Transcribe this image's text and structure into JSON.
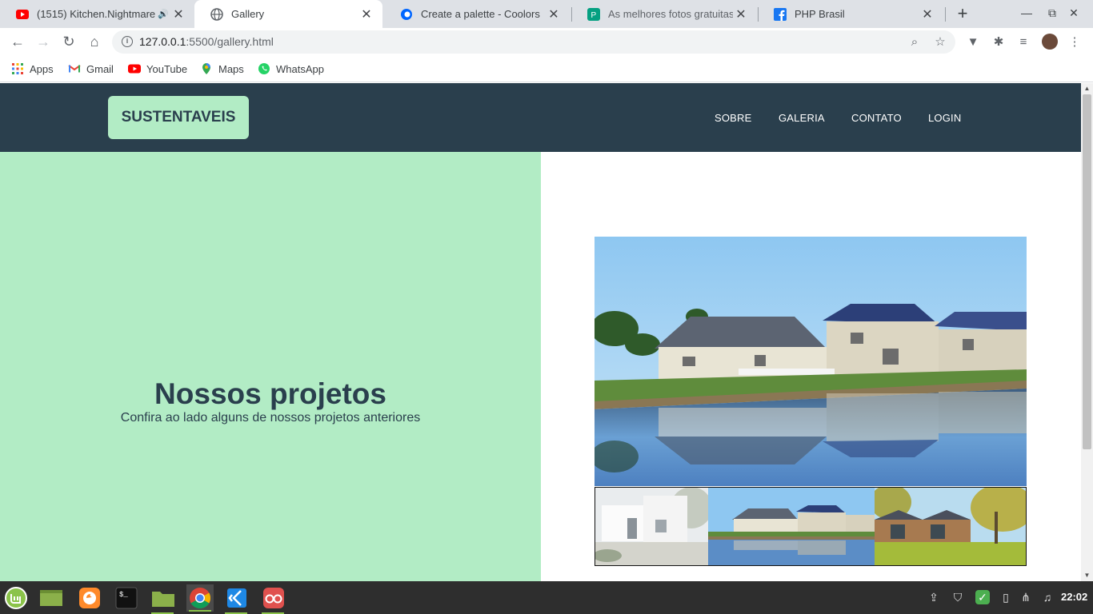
{
  "browser": {
    "tabs": [
      {
        "title": "(1515) Kitchen.Nightmare",
        "favicon": "youtube-icon",
        "active": false
      },
      {
        "title": "Gallery",
        "favicon": "globe-icon",
        "active": true
      },
      {
        "title": "Create a palette - Coolors",
        "favicon": "coolors-icon",
        "active": false
      },
      {
        "title": "As melhores fotos gratuitas",
        "favicon": "pexels-icon",
        "active": false
      },
      {
        "title": "PHP Brasil",
        "favicon": "facebook-icon",
        "active": false
      }
    ],
    "tab_close_glyph": "✕",
    "new_tab_glyph": "+",
    "url_host": "127.0.0.1",
    "url_path": ":5500/gallery.html",
    "bookmarks": [
      {
        "label": "Apps",
        "icon": "apps-grid-icon"
      },
      {
        "label": "Gmail",
        "icon": "gmail-icon"
      },
      {
        "label": "YouTube",
        "icon": "youtube-icon"
      },
      {
        "label": "Maps",
        "icon": "maps-icon"
      },
      {
        "label": "WhatsApp",
        "icon": "whatsapp-icon"
      }
    ]
  },
  "site": {
    "logo": "SUSTENTAVEIS",
    "nav": [
      "SOBRE",
      "GALERIA",
      "CONTATO",
      "LOGIN"
    ],
    "hero_title": "Nossos projetos",
    "hero_subtitle": "Confira ao lado alguns de nossos projetos anteriores",
    "colors": {
      "header": "#2a3f4d",
      "accent": "#b2ecc5"
    }
  },
  "taskbar": {
    "apps": [
      "mint-menu-icon",
      "show-desktop-icon",
      "firefox-icon",
      "terminal-icon",
      "files-icon",
      "chrome-icon",
      "vscode-icon",
      "glasses-app-icon"
    ],
    "clock": "22:02"
  }
}
